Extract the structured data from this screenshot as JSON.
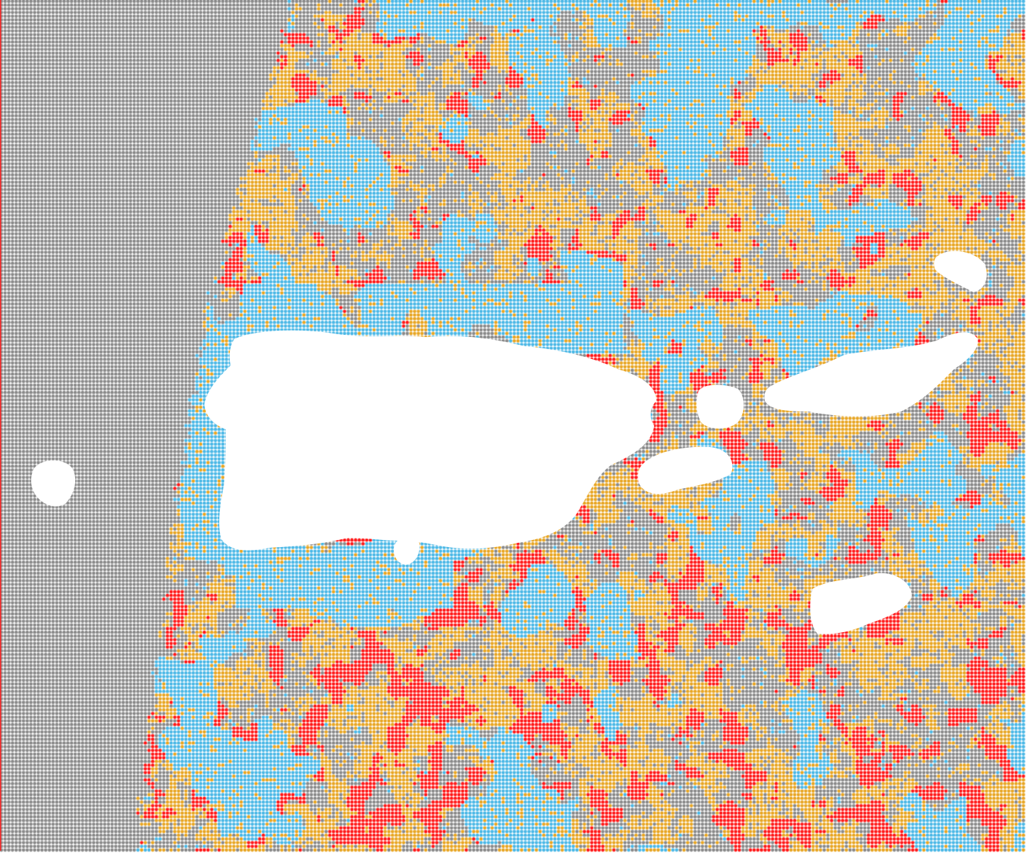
{
  "map": {
    "kind": "classified point grid map",
    "colors": {
      "background": "#ffffff",
      "grid": "#8a8a8a",
      "water": "#4bb8e6",
      "moderate": "#e8a624",
      "high": "#ff1a1a",
      "land": "#ffffff"
    },
    "class_order": [
      "grid",
      "water",
      "moderate",
      "high"
    ]
  }
}
